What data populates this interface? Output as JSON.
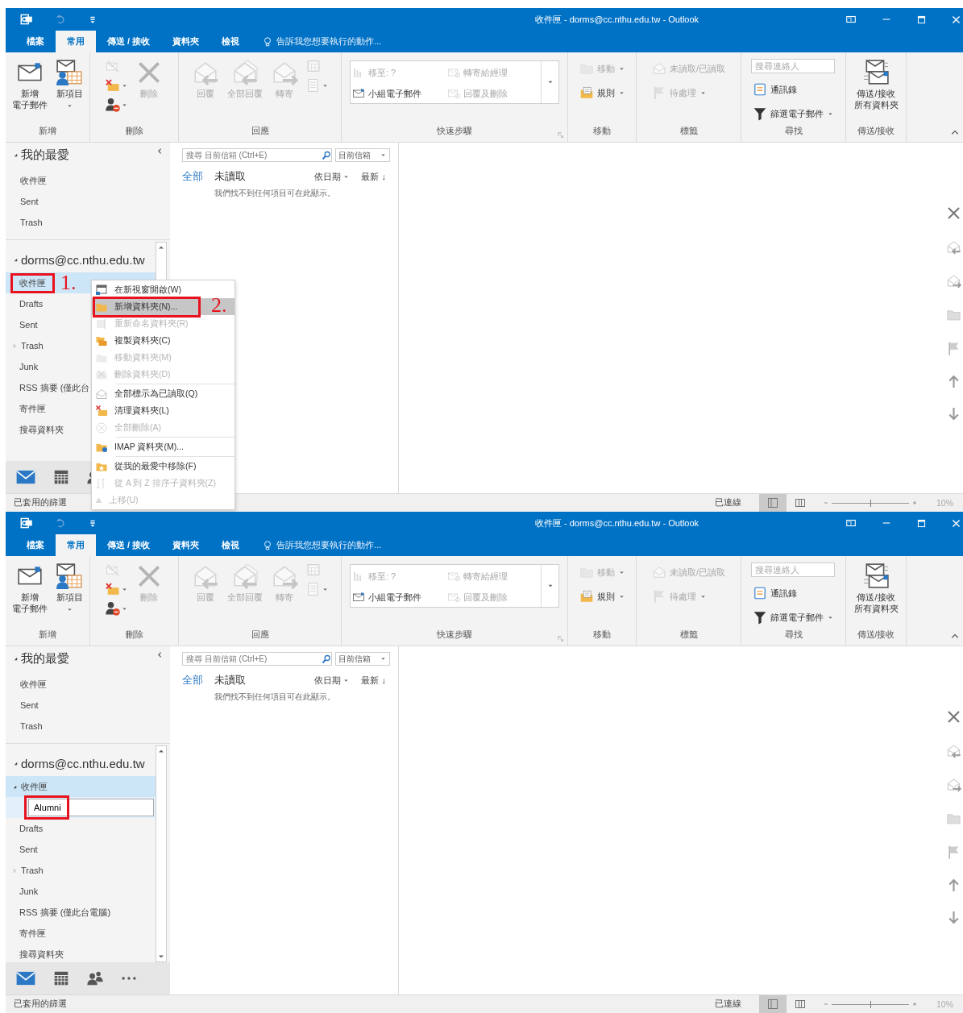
{
  "windows": [
    {
      "title": "收件匣 - dorms@cc.nthu.edu.tw - Outlook",
      "tabs": [
        {
          "label": "檔案",
          "selected": false
        },
        {
          "label": "常用",
          "selected": true
        },
        {
          "label": "傳送 / 接收",
          "selected": false
        },
        {
          "label": "資料夾",
          "selected": false
        },
        {
          "label": "檢視",
          "selected": false
        }
      ],
      "tell_me": "告訴我您想要執行的動作...",
      "ribbon": [
        {
          "label": "新增",
          "items": [
            {
              "kind": "large",
              "lines": [
                "新增",
                "電子郵件"
              ],
              "disabled": false
            },
            {
              "kind": "large",
              "label": "新項目",
              "disabled": false,
              "dropdown": true
            }
          ]
        },
        {
          "label": "刪除",
          "items": [
            {
              "kind": "stack",
              "items": [
                {
                  "kind": "icon",
                  "disabled": true
                },
                {
                  "kind": "icon",
                  "disabled": false,
                  "dropdown": true
                },
                {
                  "kind": "icon",
                  "disabled": false,
                  "dropdown": true
                }
              ]
            },
            {
              "kind": "large",
              "label": "刪除",
              "disabled": true
            }
          ]
        },
        {
          "label": "回應",
          "items": [
            {
              "kind": "large",
              "label": "回覆",
              "disabled": true
            },
            {
              "kind": "large",
              "label": "全部回覆",
              "disabled": true
            },
            {
              "kind": "large",
              "label": "轉寄",
              "disabled": true
            },
            {
              "kind": "stack",
              "items": [
                {
                  "kind": "icon",
                  "disabled": true
                },
                {
                  "kind": "icon",
                  "disabled": true,
                  "dropdown": true
                }
              ]
            }
          ]
        },
        {
          "label": "快速步驟",
          "launcher": true,
          "items": [
            {
              "kind": "gallery",
              "entries": [
                {
                  "label": "移至: ?",
                  "disabled": true
                },
                {
                  "label": "轉寄給經理",
                  "disabled": true
                },
                {
                  "label": "小組電子郵件",
                  "disabled": false
                },
                {
                  "label": "回覆及刪除",
                  "disabled": true
                }
              ]
            }
          ]
        },
        {
          "label": "移動",
          "items": [
            {
              "kind": "stack",
              "items": [
                {
                  "kind": "small",
                  "label": "移動",
                  "disabled": true,
                  "dropdown": true
                },
                {
                  "kind": "small",
                  "label": "規則",
                  "disabled": false,
                  "dropdown": true
                }
              ]
            }
          ]
        },
        {
          "label": "標籤",
          "items": [
            {
              "kind": "stack",
              "items": [
                {
                  "kind": "small",
                  "label": "未讀取/已讀取",
                  "disabled": true
                },
                {
                  "kind": "small",
                  "label": "待處理",
                  "disabled": true,
                  "dropdown": true
                }
              ]
            }
          ]
        },
        {
          "label": "尋找",
          "items": [
            {
              "kind": "stack",
              "items": [
                {
                  "kind": "search",
                  "placeholder": "搜尋連絡人"
                },
                {
                  "kind": "small",
                  "label": "通訊錄",
                  "disabled": false
                },
                {
                  "kind": "small",
                  "label": "篩選電子郵件",
                  "disabled": false,
                  "dropdown": true
                }
              ]
            }
          ]
        },
        {
          "label": "傳送/接收",
          "items": [
            {
              "kind": "large",
              "lines": [
                "傳送/接收",
                "所有資料夾"
              ],
              "disabled": false
            }
          ]
        }
      ],
      "favorites": {
        "label": "我的最愛",
        "expanded": true,
        "folders": [
          {
            "label": "收件匣",
            "selected": false
          },
          {
            "label": "Sent",
            "selected": false
          },
          {
            "label": "Trash",
            "selected": false
          }
        ]
      },
      "account": {
        "label": "dorms@cc.nthu.edu.tw",
        "expanded": true,
        "folders": [
          {
            "label": "收件匣",
            "selected": true,
            "marked": true,
            "step": "1."
          },
          {
            "label": "Drafts",
            "selected": false
          },
          {
            "label": "Sent",
            "selected": false
          },
          {
            "label": "Trash",
            "selected": false,
            "expanded": false
          },
          {
            "label": "Junk",
            "selected": false
          },
          {
            "label": "RSS 摘要 (僅此台",
            "selected": false
          },
          {
            "label": "寄件匣",
            "selected": false
          },
          {
            "label": "搜尋資料夾",
            "selected": false
          }
        ]
      },
      "bottom_nav": [
        {
          "selected": true
        },
        {
          "selected": false
        },
        {
          "selected": false
        }
      ],
      "list": {
        "search": {
          "placeholder": "搜尋 目前信箱 (Ctrl+E)",
          "scope": "目前信箱"
        },
        "filters": [
          {
            "label": "全部",
            "selected": true
          },
          {
            "label": "未讀取",
            "selected": false
          }
        ],
        "arrange": "依日期",
        "order": "最新 ↓",
        "empty": "我們找不到任何項目可在此顯示。"
      },
      "context_menu": {
        "items": [
          {
            "label": "在新視窗開啟(W)",
            "disabled": false,
            "selected": false
          },
          {
            "label": "新增資料夾(N)...",
            "disabled": false,
            "selected": true,
            "marked": true,
            "step": "2."
          },
          {
            "label": "重新命名資料夾(R)",
            "disabled": true,
            "selected": false
          },
          {
            "label": "複製資料夾(C)",
            "disabled": false,
            "selected": false
          },
          {
            "label": "移動資料夾(M)",
            "disabled": true,
            "selected": false
          },
          {
            "label": "刪除資料夾(D)",
            "disabled": true,
            "selected": false
          },
          {
            "label": "全部標示為已讀取(Q)",
            "disabled": false,
            "selected": false,
            "group_start": true
          },
          {
            "label": "清理資料夾(L)",
            "disabled": false,
            "selected": false
          },
          {
            "label": "全部刪除(A)",
            "disabled": true,
            "selected": false
          },
          {
            "label": "IMAP 資料夾(M)...",
            "disabled": false,
            "selected": false,
            "group_start": true
          },
          {
            "label": "從我的最愛中移除(F)",
            "disabled": false,
            "selected": false,
            "group_start": true
          },
          {
            "label": "從 A 到 Z 排序子資料夾(Z)",
            "disabled": true,
            "selected": false
          },
          {
            "label": "上移(U)",
            "disabled": true,
            "selected": false
          }
        ]
      },
      "status": {
        "left": "已套用的篩選",
        "connection": "已連線",
        "views": [
          {
            "selected": true
          },
          {
            "selected": false
          }
        ],
        "zoom_slider": {
          "level": 0.5
        },
        "zoom": "10%"
      }
    },
    {
      "title": "收件匣 - dorms@cc.nthu.edu.tw - Outlook",
      "tabs": [
        {
          "label": "檔案",
          "selected": false
        },
        {
          "label": "常用",
          "selected": true
        },
        {
          "label": "傳送 / 接收",
          "selected": false
        },
        {
          "label": "資料夾",
          "selected": false
        },
        {
          "label": "檢視",
          "selected": false
        }
      ],
      "tell_me": "告訴我您想要執行的動作...",
      "ribbon": [
        {
          "label": "新增",
          "items": [
            {
              "kind": "large",
              "lines": [
                "新增",
                "電子郵件"
              ],
              "disabled": false
            },
            {
              "kind": "large",
              "label": "新項目",
              "disabled": false,
              "dropdown": true
            }
          ]
        },
        {
          "label": "刪除",
          "items": [
            {
              "kind": "stack",
              "items": [
                {
                  "kind": "icon",
                  "disabled": true
                },
                {
                  "kind": "icon",
                  "disabled": false,
                  "dropdown": true
                },
                {
                  "kind": "icon",
                  "disabled": false,
                  "dropdown": true
                }
              ]
            },
            {
              "kind": "large",
              "label": "刪除",
              "disabled": true
            }
          ]
        },
        {
          "label": "回應",
          "items": [
            {
              "kind": "large",
              "label": "回覆",
              "disabled": true
            },
            {
              "kind": "large",
              "label": "全部回覆",
              "disabled": true
            },
            {
              "kind": "large",
              "label": "轉寄",
              "disabled": true
            },
            {
              "kind": "stack",
              "items": [
                {
                  "kind": "icon",
                  "disabled": true
                },
                {
                  "kind": "icon",
                  "disabled": true,
                  "dropdown": true
                }
              ]
            }
          ]
        },
        {
          "label": "快速步驟",
          "launcher": true,
          "items": [
            {
              "kind": "gallery",
              "entries": [
                {
                  "label": "移至: ?",
                  "disabled": true
                },
                {
                  "label": "轉寄給經理",
                  "disabled": true
                },
                {
                  "label": "小組電子郵件",
                  "disabled": false
                },
                {
                  "label": "回覆及刪除",
                  "disabled": true
                }
              ]
            }
          ]
        },
        {
          "label": "移動",
          "items": [
            {
              "kind": "stack",
              "items": [
                {
                  "kind": "small",
                  "label": "移動",
                  "disabled": true,
                  "dropdown": true
                },
                {
                  "kind": "small",
                  "label": "規則",
                  "disabled": false,
                  "dropdown": true
                }
              ]
            }
          ]
        },
        {
          "label": "標籤",
          "items": [
            {
              "kind": "stack",
              "items": [
                {
                  "kind": "small",
                  "label": "未讀取/已讀取",
                  "disabled": true
                },
                {
                  "kind": "small",
                  "label": "待處理",
                  "disabled": true,
                  "dropdown": true
                }
              ]
            }
          ]
        },
        {
          "label": "尋找",
          "items": [
            {
              "kind": "stack",
              "items": [
                {
                  "kind": "search",
                  "placeholder": "搜尋連絡人"
                },
                {
                  "kind": "small",
                  "label": "通訊錄",
                  "disabled": false
                },
                {
                  "kind": "small",
                  "label": "篩選電子郵件",
                  "disabled": false,
                  "dropdown": true
                }
              ]
            }
          ]
        },
        {
          "label": "傳送/接收",
          "items": [
            {
              "kind": "large",
              "lines": [
                "傳送/接收",
                "所有資料夾"
              ],
              "disabled": false
            }
          ]
        }
      ],
      "favorites": {
        "label": "我的最愛",
        "expanded": true,
        "folders": [
          {
            "label": "收件匣",
            "selected": false
          },
          {
            "label": "Sent",
            "selected": false
          },
          {
            "label": "Trash",
            "selected": false
          }
        ]
      },
      "account": {
        "label": "dorms@cc.nthu.edu.tw",
        "expanded": true,
        "folders": [
          {
            "label": "收件匣",
            "selected": true,
            "expanded": true,
            "children": [
              {
                "kind": "edit",
                "value": "Alumni",
                "marked": true
              }
            ]
          },
          {
            "label": "Drafts",
            "selected": false
          },
          {
            "label": "Sent",
            "selected": false
          },
          {
            "label": "Trash",
            "selected": false,
            "expanded": false
          },
          {
            "label": "Junk",
            "selected": false
          },
          {
            "label": "RSS 摘要 (僅此台電腦)",
            "selected": false
          },
          {
            "label": "寄件匣",
            "selected": false
          },
          {
            "label": "搜尋資料夾",
            "selected": false
          }
        ]
      },
      "bottom_nav": [
        {
          "selected": true
        },
        {
          "selected": false
        },
        {
          "selected": false
        },
        {
          "selected": false
        }
      ],
      "list": {
        "search": {
          "placeholder": "搜尋 目前信箱 (Ctrl+E)",
          "scope": "目前信箱"
        },
        "filters": [
          {
            "label": "全部",
            "selected": true
          },
          {
            "label": "未讀取",
            "selected": false
          }
        ],
        "arrange": "依日期",
        "order": "最新 ↓",
        "empty": "我們找不到任何項目可在此顯示。"
      },
      "status": {
        "left": "已套用的篩選",
        "connection": "已連線",
        "views": [
          {
            "selected": true
          },
          {
            "selected": false
          }
        ],
        "zoom_slider": {
          "level": 0.5
        },
        "zoom": "10%"
      }
    }
  ]
}
